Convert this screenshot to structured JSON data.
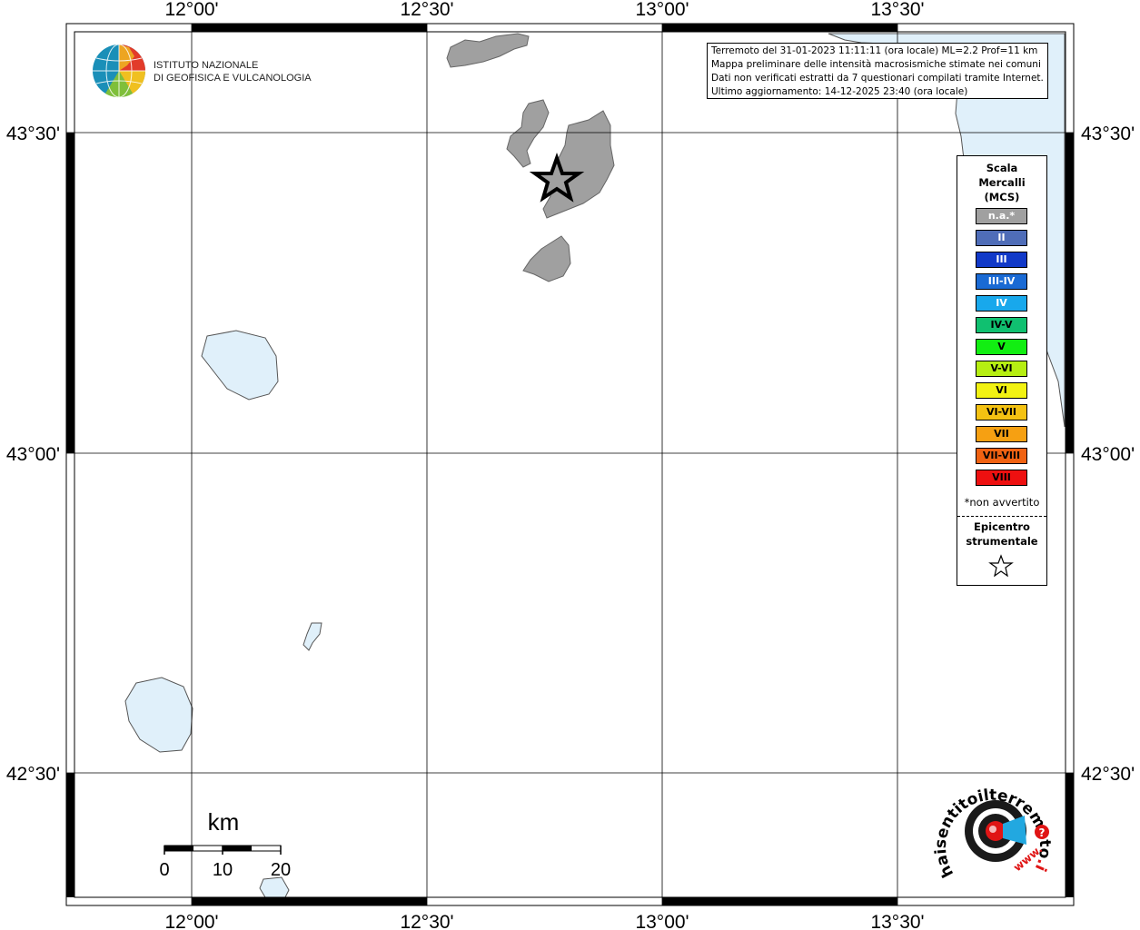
{
  "header": {
    "institute_line1": "ISTITUTO NAZIONALE",
    "institute_line2": "DI GEOFISICA E VULCANOLOGIA"
  },
  "info": {
    "line1": "Terremoto del 31-01-2023 11:11:11 (ora locale) ML=2.2 Prof=11 km",
    "line2": "Mappa preliminare delle intensità macrosismiche stimate nei comuni",
    "line3": "Dati non verificati estratti da 7 questionari compilati tramite Internet.",
    "line4": "Ultimo aggiornamento: 14-12-2025 23:40 (ora locale)"
  },
  "axes": {
    "lon_ticks": [
      "12°00'",
      "12°30'",
      "13°00'",
      "13°30'"
    ],
    "lat_ticks": [
      "43°30'",
      "43°00'",
      "42°30'"
    ]
  },
  "legend": {
    "title_lines": [
      "Scala",
      "Mercalli",
      "(MCS)"
    ],
    "classes": [
      {
        "label": "n.a.*",
        "color": "#a0a0a0",
        "text_color": "#ffffff"
      },
      {
        "label": "II",
        "color": "#4f6db8",
        "text_color": "#ffffff"
      },
      {
        "label": "III",
        "color": "#1139c8",
        "text_color": "#ffffff"
      },
      {
        "label": "III-IV",
        "color": "#1a6ad4",
        "text_color": "#ffffff"
      },
      {
        "label": "IV",
        "color": "#18a8ec",
        "text_color": "#ffffff"
      },
      {
        "label": "IV-V",
        "color": "#10c070",
        "text_color": "#000000"
      },
      {
        "label": "V",
        "color": "#12ee12",
        "text_color": "#000000"
      },
      {
        "label": "V-VI",
        "color": "#b6ee12",
        "text_color": "#000000"
      },
      {
        "label": "VI",
        "color": "#f2f212",
        "text_color": "#000000"
      },
      {
        "label": "VI-VII",
        "color": "#f4c212",
        "text_color": "#000000"
      },
      {
        "label": "VII",
        "color": "#f6a012",
        "text_color": "#000000"
      },
      {
        "label": "VII-VIII",
        "color": "#f06212",
        "text_color": "#000000"
      },
      {
        "label": "VIII",
        "color": "#ee1010",
        "text_color": "#000000"
      }
    ],
    "note": "*non avvertito",
    "epicenter_lines": [
      "Epicentro",
      "strumentale"
    ]
  },
  "scale_bar": {
    "unit": "km",
    "ticks": [
      "0",
      "10",
      "20"
    ]
  },
  "hsit_logo": {
    "text_main": "haisentitoilterremoto",
    "text_tld": ".it",
    "text_www": "www.",
    "question_mark": "?"
  },
  "colors": {
    "land": "#ffffff",
    "water": "#e0f0fa",
    "municipality_na": "#a0a0a0",
    "grid": "#000000"
  }
}
